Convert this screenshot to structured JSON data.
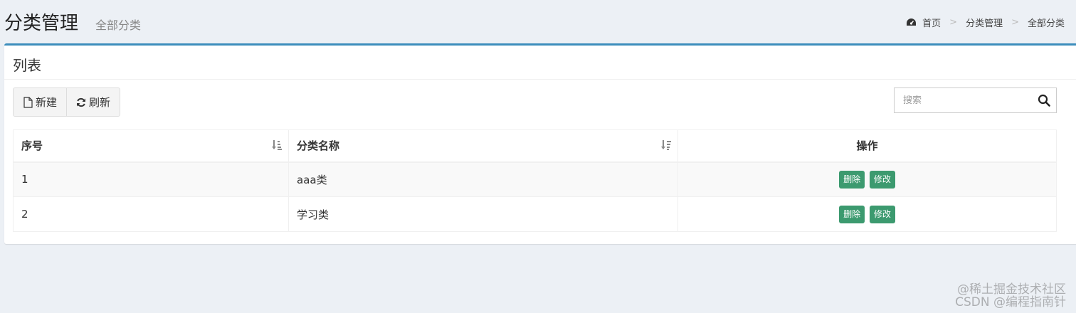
{
  "header": {
    "title": "分类管理",
    "subtitle": "全部分类",
    "breadcrumb": [
      "首页",
      "分类管理",
      "全部分类"
    ],
    "separator": ">"
  },
  "box": {
    "title": "列表",
    "toolbar": {
      "new_label": "新建",
      "refresh_label": "刷新"
    },
    "search": {
      "placeholder": "搜索",
      "value": ""
    }
  },
  "table": {
    "columns": [
      "序号",
      "分类名称",
      "操作"
    ],
    "rows": [
      {
        "index": "1",
        "name": "aaa类",
        "delete_label": "删除",
        "edit_label": "修改"
      },
      {
        "index": "2",
        "name": "学习类",
        "delete_label": "删除",
        "edit_label": "修改"
      }
    ]
  },
  "watermark": {
    "line1": "@稀土掘金技术社区",
    "line2": "CSDN @编程指南针"
  },
  "colors": {
    "accent": "#3c8dbc",
    "action_button": "#3c9a6f",
    "background": "#ecf0f5"
  },
  "icons": {
    "home": "dashboard-icon",
    "new": "file-icon",
    "refresh": "refresh-icon",
    "search": "search-icon"
  }
}
